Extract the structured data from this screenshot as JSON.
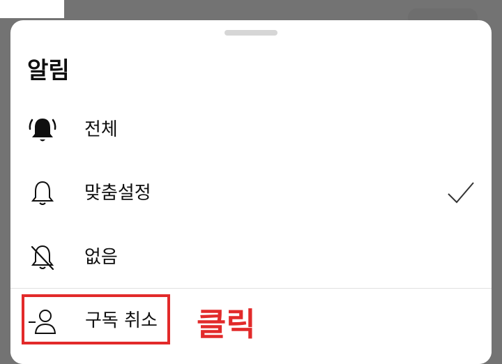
{
  "sheet": {
    "title": "알림",
    "options": [
      {
        "label": "전체",
        "icon": "bell-ringing-filled-icon",
        "selected": false
      },
      {
        "label": "맞춤설정",
        "icon": "bell-outline-icon",
        "selected": true
      },
      {
        "label": "없음",
        "icon": "bell-off-icon",
        "selected": false
      }
    ],
    "unsubscribe": {
      "label": "구독 취소",
      "icon": "person-remove-icon"
    }
  },
  "annotation": {
    "text": "클릭",
    "color": "#e22a2a"
  },
  "colors": {
    "overlay": "#737373",
    "sheet": "#ffffff",
    "text": "#0f0f0f",
    "divider": "#e0e0e0"
  }
}
